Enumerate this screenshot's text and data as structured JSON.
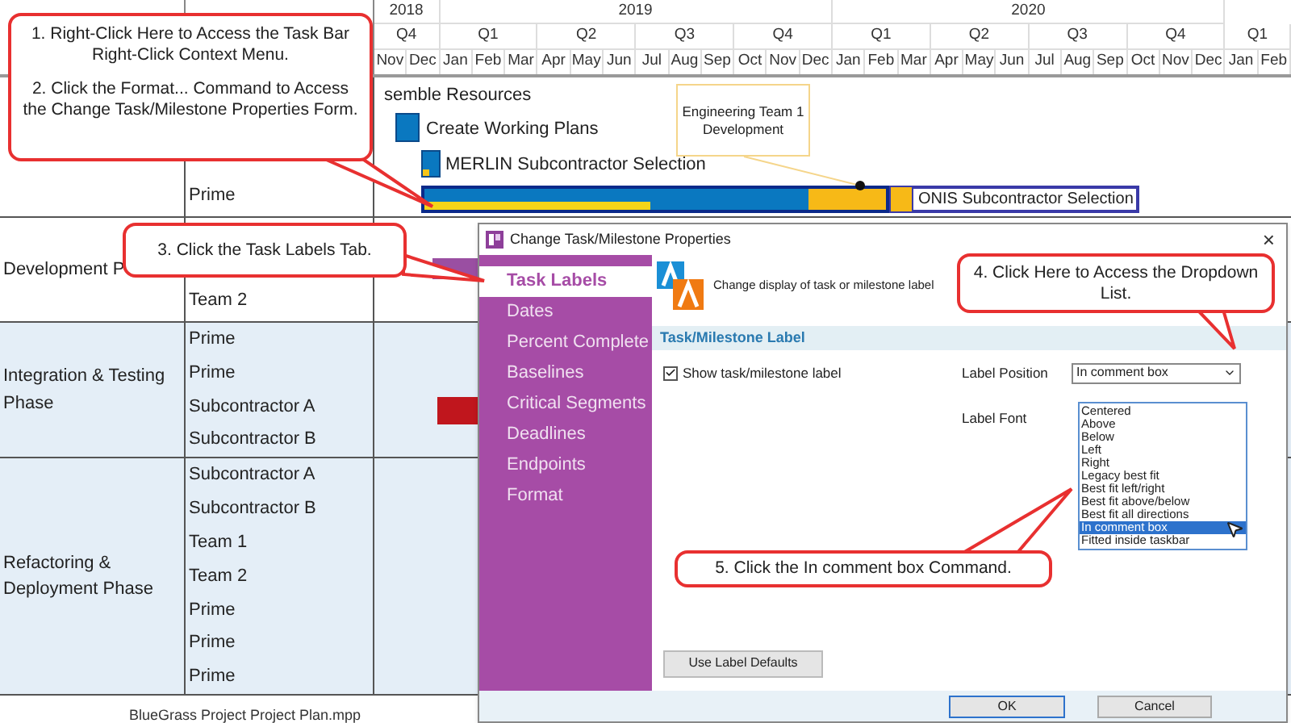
{
  "timescale": {
    "years": [
      "2018",
      "2019",
      "2020"
    ],
    "quarters": [
      "Q4",
      "Q1",
      "Q2",
      "Q3",
      "Q4",
      "Q1",
      "Q2",
      "Q3",
      "Q4",
      "Q1"
    ],
    "months": [
      "Nov",
      "Dec",
      "Jan",
      "Feb",
      "Mar",
      "Apr",
      "May",
      "Jun",
      "Jul",
      "Aug",
      "Sep",
      "Oct",
      "Nov",
      "Dec",
      "Jan",
      "Feb",
      "Mar",
      "Apr",
      "May",
      "Jun",
      "Jul",
      "Aug",
      "Sep",
      "Oct",
      "Nov",
      "Dec",
      "Jan",
      "Feb"
    ]
  },
  "gantt": {
    "partial_task": "semble Resources",
    "task_1": "Create Working Plans",
    "task_2": "MERLIN Subcontractor Selection",
    "task_3": "ONIS Subcontractor Selection",
    "comment": "Engineering Team 1 Development"
  },
  "groups": [
    {
      "resources": [
        "Prime"
      ]
    },
    {
      "phase": "Development P",
      "resources": [
        "Team 2"
      ]
    },
    {
      "phase": "Integration & Testing Phase",
      "resources": [
        "Prime",
        "Prime",
        "Subcontractor A",
        "Subcontractor B"
      ]
    },
    {
      "phase": "Refactoring & Deployment Phase",
      "resources": [
        "Subcontractor A",
        "Subcontractor B",
        "Team 1",
        "Team 2",
        "Prime",
        "Prime",
        "Prime"
      ]
    }
  ],
  "footer": "BlueGrass Project Project Plan.mpp",
  "dialog": {
    "title": "Change Task/Milestone Properties",
    "close": "×",
    "tabs": [
      {
        "label": "Task Labels",
        "selected": true
      },
      {
        "label": "Dates",
        "selected": false
      },
      {
        "label": "Percent Complete",
        "selected": false
      },
      {
        "label": "Baselines",
        "selected": false
      },
      {
        "label": "Critical Segments",
        "selected": false
      },
      {
        "label": "Deadlines",
        "selected": false
      },
      {
        "label": "Endpoints",
        "selected": false
      },
      {
        "label": "Format",
        "selected": false
      }
    ],
    "description": "Change display of task or milestone label",
    "section": "Task/Milestone Label",
    "show_label": {
      "label": "Show task/milestone label",
      "checked": true
    },
    "label_position": {
      "label": "Label Position",
      "value": "In comment box"
    },
    "options": [
      {
        "label": "Centered",
        "selected": false
      },
      {
        "label": "Above",
        "selected": false
      },
      {
        "label": "Below",
        "selected": false
      },
      {
        "label": "Left",
        "selected": false
      },
      {
        "label": "Right",
        "selected": false
      },
      {
        "label": "Legacy best fit",
        "selected": false
      },
      {
        "label": "Best fit left/right",
        "selected": false
      },
      {
        "label": "Best fit above/below",
        "selected": false
      },
      {
        "label": "Best fit all directions",
        "selected": false
      },
      {
        "label": "In comment box",
        "selected": true
      },
      {
        "label": "Fitted inside taskbar",
        "selected": false
      }
    ],
    "label_font": "Label Font",
    "defaults_button": "Use Label Defaults",
    "ok": "OK",
    "cancel": "Cancel"
  },
  "callouts": [
    {
      "texts": [
        "1. Right-Click Here to Access the Task Bar Right-Click Context Menu.",
        "2. Click the Format... Command to Access the Change Task/Milestone Properties Form."
      ]
    },
    {
      "texts": [
        "3. Click the Task Labels Tab."
      ]
    },
    {
      "texts": [
        "4. Click Here to Access the Dropdown List."
      ]
    },
    {
      "texts": [
        "5. Click the In comment box Command."
      ]
    }
  ]
}
